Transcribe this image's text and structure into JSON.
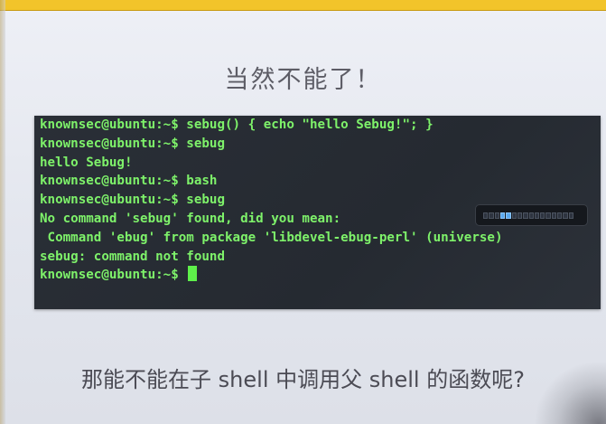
{
  "slide": {
    "title": "当然不能了！",
    "footer": "那能不能在子 shell 中调用父 shell 的函数呢?"
  },
  "terminal": {
    "lines": [
      "knownsec@ubuntu:~$ sebug() { echo \"hello Sebug!\"; }",
      "knownsec@ubuntu:~$ sebug",
      "hello Sebug!",
      "knownsec@ubuntu:~$ bash",
      "knownsec@ubuntu:~$ sebug",
      "No command 'sebug' found, did you mean:",
      " Command 'ebug' from package 'libdevel-ebug-perl' (universe)",
      "sebug: command not found",
      "knownsec@ubuntu:~$ "
    ],
    "text_color": "#7ef26a",
    "background_color": "#262b32"
  },
  "volume_osd": {
    "level": 0.25,
    "segments": 16,
    "accent_color": "#5aa9f0"
  },
  "colors": {
    "top_bar": "#f2c42a",
    "slide_background": "#e6e8ef"
  }
}
